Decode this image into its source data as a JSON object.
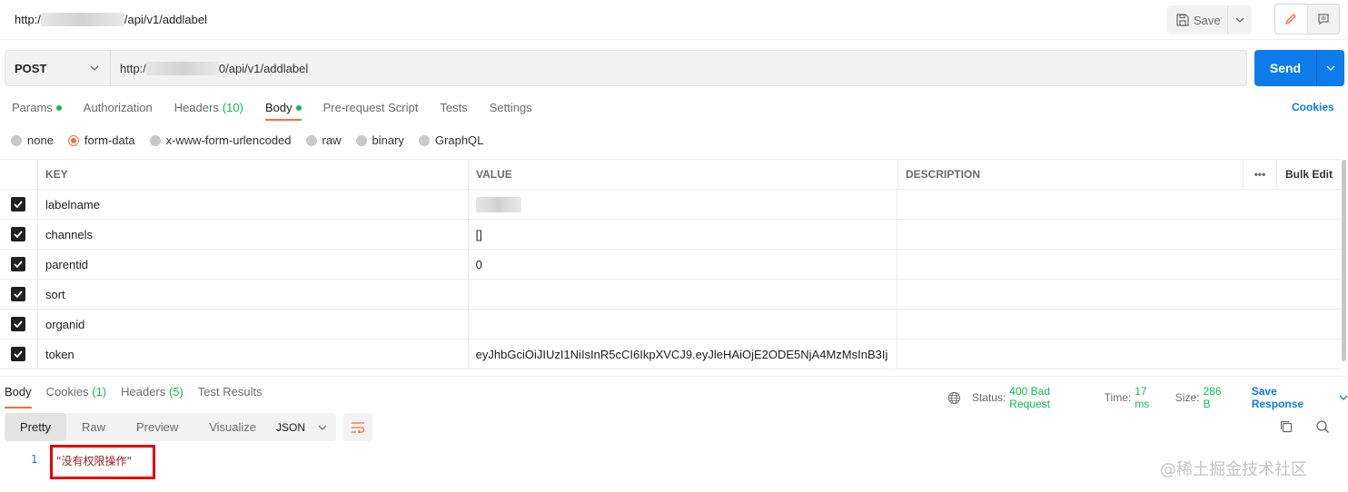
{
  "topbar": {
    "url_prefix": "http:/",
    "url_suffix": "/api/v1/addlabel",
    "save_label": "Save"
  },
  "request": {
    "method": "POST",
    "url_prefix": "http:/",
    "url_suffix": "0/api/v1/addlabel",
    "send_label": "Send"
  },
  "tabs": [
    {
      "label": "Params",
      "dot": true
    },
    {
      "label": "Authorization"
    },
    {
      "label": "Headers",
      "count": "(10)"
    },
    {
      "label": "Body",
      "dot": true,
      "active": true
    },
    {
      "label": "Pre-request Script"
    },
    {
      "label": "Tests"
    },
    {
      "label": "Settings"
    }
  ],
  "cookies_label": "Cookies",
  "body_types": [
    {
      "label": "none"
    },
    {
      "label": "form-data",
      "selected": true
    },
    {
      "label": "x-www-form-urlencoded"
    },
    {
      "label": "raw"
    },
    {
      "label": "binary"
    },
    {
      "label": "GraphQL"
    }
  ],
  "kv_table": {
    "headers": {
      "key": "KEY",
      "value": "VALUE",
      "description": "DESCRIPTION",
      "more": "•••",
      "bulk_edit": "Bulk Edit"
    },
    "rows": [
      {
        "key": "labelname",
        "value": "",
        "checked": true
      },
      {
        "key": "channels",
        "value": "[]",
        "checked": true
      },
      {
        "key": "parentid",
        "value": "0",
        "checked": true
      },
      {
        "key": "sort",
        "value": "",
        "checked": true
      },
      {
        "key": "organid",
        "value": "",
        "checked": true
      },
      {
        "key": "token",
        "value": "eyJhbGciOiJIUzI1NiIsInR5cCI6IkpXVCJ9.eyJleHAiOjE2ODE5NjA4MzMsInB3Ij",
        "checked": true
      }
    ]
  },
  "response": {
    "tabs": [
      {
        "label": "Body",
        "active": true
      },
      {
        "label": "Cookies",
        "count": "(1)"
      },
      {
        "label": "Headers",
        "count": "(5)"
      },
      {
        "label": "Test Results"
      }
    ],
    "status_label": "Status:",
    "status_value": "400 Bad Request",
    "time_label": "Time:",
    "time_value": "17 ms",
    "size_label": "Size:",
    "size_value": "286 B",
    "save_response": "Save Response",
    "formats": [
      "Pretty",
      "Raw",
      "Preview",
      "Visualize"
    ],
    "active_format": "Pretty",
    "language": "JSON",
    "line_number": "1",
    "body_text": "\"没有权限操作\""
  },
  "watermark": "@稀土掘金技术社区",
  "colors": {
    "accent": "#ff6c37",
    "send": "#0d7be9",
    "success": "#0cbb52",
    "highlight_box": "#e60000"
  }
}
